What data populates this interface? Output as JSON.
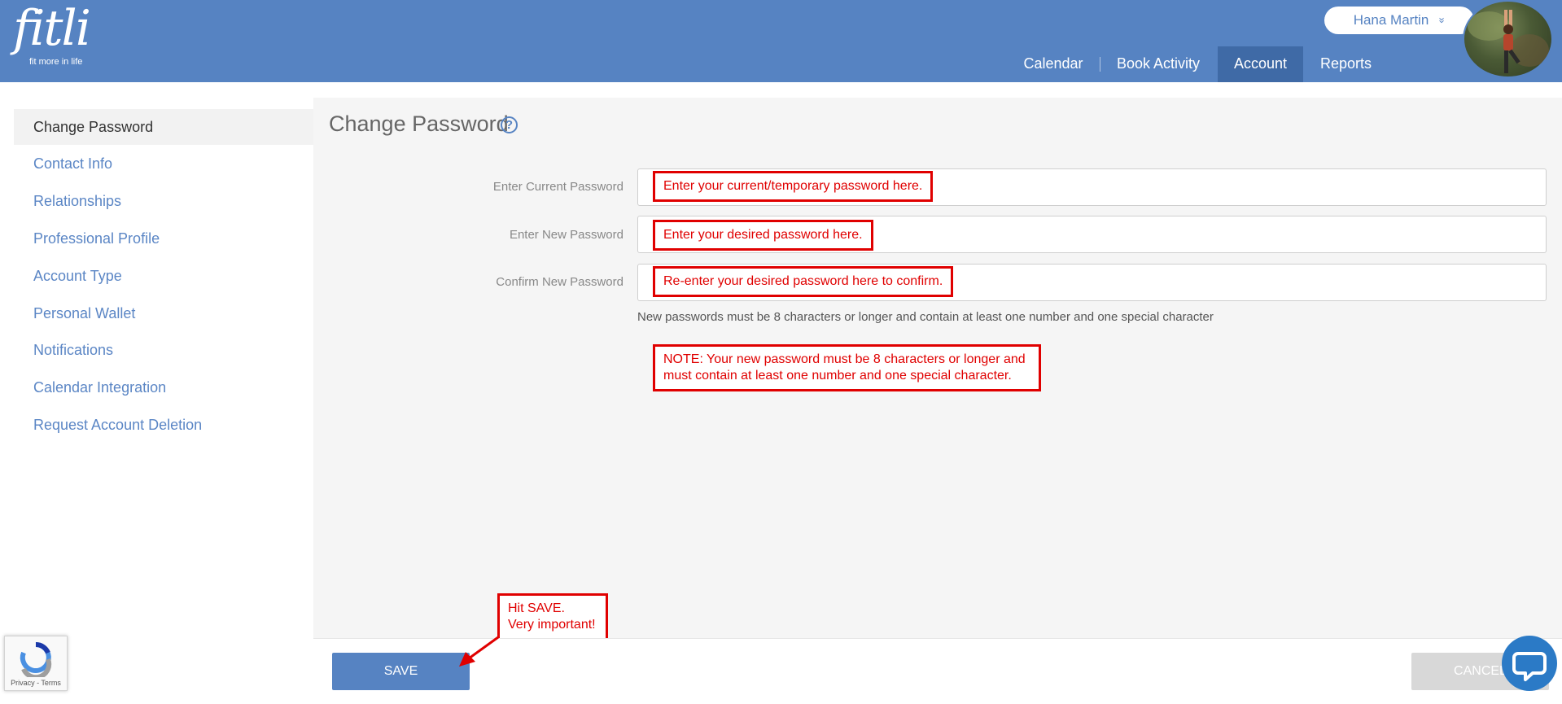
{
  "header": {
    "logo_text": "fitli",
    "logo_tagline": "fit more in life",
    "user_name": "Hana Martin",
    "user_chevron": "»",
    "nav": [
      {
        "label": "Calendar"
      },
      {
        "label": "Book Activity"
      },
      {
        "label": "Account",
        "active": true
      },
      {
        "label": "Reports"
      }
    ]
  },
  "sidebar": {
    "items": [
      {
        "label": "Change Password",
        "active": true
      },
      {
        "label": "Contact Info"
      },
      {
        "label": "Relationships"
      },
      {
        "label": "Professional Profile"
      },
      {
        "label": "Account Type"
      },
      {
        "label": "Personal Wallet"
      },
      {
        "label": "Notifications"
      },
      {
        "label": "Calendar Integration"
      },
      {
        "label": "Request Account Deletion"
      }
    ]
  },
  "main": {
    "title": "Change Password",
    "help_glyph": "?",
    "fields": [
      {
        "label": "Enter Current Password",
        "value": ""
      },
      {
        "label": "Enter New Password",
        "value": ""
      },
      {
        "label": "Confirm New Password",
        "value": ""
      }
    ],
    "hint": "New passwords must be 8 characters or longer and contain at least one number and one special character"
  },
  "annotations": {
    "current": "Enter your current/temporary password here.",
    "new": "Enter your desired password here.",
    "confirm": "Re-enter your desired password here to confirm.",
    "note_line1": "NOTE: Your new password must be 8 characters or longer and",
    "note_line2": "must contain at least one number and one special character.",
    "save_line1": "Hit SAVE.",
    "save_line2": "Very important!"
  },
  "footer": {
    "save_label": "SAVE",
    "cancel_label": "CANCEL"
  },
  "recaptcha": {
    "links": "Privacy - Terms"
  },
  "colors": {
    "brand_blue": "#5683c2",
    "nav_active": "#3f6aa6",
    "annotation_red": "#e00000",
    "chat_blue": "#2b7ac6"
  },
  "icons": [
    "help-icon",
    "chevron-down-icon",
    "chat-icon",
    "recaptcha-icon",
    "avatar-photo"
  ]
}
